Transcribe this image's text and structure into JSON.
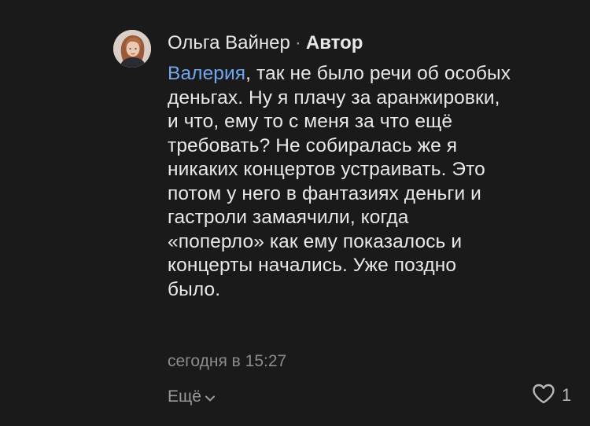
{
  "comment": {
    "author": "Ольга Вайнер",
    "separator": "·",
    "role": "Автор",
    "mention": "Валерия",
    "text_first_line_rest": ", так не было речи об особых",
    "text_lines": [
      "деньгах. Ну я плачу за аранжировки,",
      "и что, ему то с меня за что ещё",
      "требовать? Не собиралась же я",
      "никаких концертов устраивать. Это",
      "потом у него в фантазиях деньги и",
      "гастроли замаячили, когда",
      "«поперло» как ему показалось и",
      "концерты начались. Уже поздно",
      "было."
    ],
    "timestamp": "сегодня в 15:27",
    "more_label": "Ещё",
    "likes": "1"
  },
  "colors": {
    "background": "#1a1a1a",
    "text": "#e8e8e8",
    "mention": "#71a7ee",
    "muted": "#8c8c8c"
  },
  "icons": {
    "more": "chevron-down-icon",
    "like": "heart-outline-icon"
  }
}
